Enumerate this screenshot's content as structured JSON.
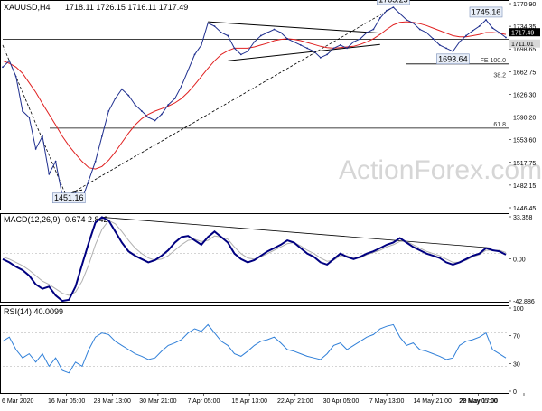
{
  "header": {
    "symbol": "XAUUSD,H4",
    "ohlc": "1718.11 1726.15 1716.11 1717.49"
  },
  "watermark": "ActionForex.com",
  "colors": {
    "price": "#1f2f8f",
    "ma": "#e02020",
    "macd_line": "#000080",
    "macd_signal": "#b0b0b0",
    "rsi": "#2f7fd8",
    "trend": "#000000",
    "level_box": "#e8eef8"
  },
  "chart_data": [
    {
      "type": "line",
      "title": "XAUUSD,H4",
      "ylim": [
        1446.45,
        1770.9
      ],
      "y_ticks": [
        "1770.90",
        "1734.35",
        "1698.65",
        "1662.75",
        "1626.30",
        "1590.20",
        "1553.60",
        "1517.75",
        "1482.15",
        "1446.45"
      ],
      "current_price_labels": [
        "1717.49",
        "1711.01"
      ],
      "x_ticks": [
        "6 Mar 2020",
        "16 Mar 05:00",
        "23 Mar 13:00",
        "30 Mar 21:00",
        "7 Apr 05:00",
        "15 Apr 13:00",
        "22 Apr 21:00",
        "30 Apr 05:00",
        "7 May 13:00",
        "14 May 21:00",
        "22 May 05:00",
        "29 May 17:00"
      ],
      "annotations": [
        {
          "text": "1451.16",
          "price": 1451.16
        },
        {
          "text": "1765.25",
          "price": 1765.25
        },
        {
          "text": "1745.16",
          "price": 1745.16
        },
        {
          "text": "1693.64",
          "price": 1693.64
        }
      ],
      "levels": [
        {
          "label": "FE 100.0",
          "price": 1675
        },
        {
          "label": "38.2",
          "price": 1651
        },
        {
          "label": "61.8",
          "price": 1573
        }
      ],
      "series": [
        {
          "values": [
            1670,
            1680,
            1655,
            1600,
            1590,
            1540,
            1560,
            1500,
            1520,
            1465,
            1455,
            1470,
            1460,
            1490,
            1520,
            1560,
            1600,
            1620,
            1635,
            1625,
            1610,
            1600,
            1590,
            1585,
            1595,
            1610,
            1620,
            1640,
            1665,
            1690,
            1705,
            1740,
            1735,
            1725,
            1720,
            1700,
            1690,
            1695,
            1710,
            1720,
            1725,
            1730,
            1725,
            1715,
            1710,
            1705,
            1700,
            1695,
            1685,
            1690,
            1700,
            1705,
            1700,
            1710,
            1715,
            1725,
            1730,
            1748,
            1760,
            1765,
            1755,
            1745,
            1740,
            1730,
            1725,
            1715,
            1705,
            1700,
            1695,
            1710,
            1720,
            1728,
            1735,
            1745,
            1732,
            1725,
            1717
          ]
        },
        {
          "values": [
            1680,
            1676,
            1670,
            1660,
            1645,
            1630,
            1612,
            1595,
            1578,
            1560,
            1545,
            1532,
            1520,
            1510,
            1508,
            1512,
            1522,
            1535,
            1550,
            1565,
            1578,
            1588,
            1595,
            1600,
            1604,
            1608,
            1613,
            1620,
            1630,
            1642,
            1655,
            1668,
            1680,
            1690,
            1696,
            1700,
            1700,
            1700,
            1702,
            1705,
            1708,
            1712,
            1714,
            1715,
            1714,
            1712,
            1709,
            1706,
            1703,
            1701,
            1700,
            1701,
            1702,
            1703,
            1706,
            1710,
            1715,
            1722,
            1730,
            1737,
            1741,
            1742,
            1741,
            1739,
            1736,
            1732,
            1728,
            1724,
            1720,
            1718,
            1718,
            1720,
            1722,
            1725,
            1725,
            1724,
            1722
          ]
        }
      ]
    },
    {
      "type": "line",
      "title": "MACD(12,26,9) -0.674 2.842",
      "ylim": [
        -42.886,
        33.358
      ],
      "y_ticks": [
        "33.358",
        "0.00",
        "-42.886"
      ],
      "series": [
        {
          "values": [
            -5,
            -8,
            -12,
            -15,
            -20,
            -28,
            -32,
            -30,
            -38,
            -43,
            -42,
            -30,
            -10,
            10,
            28,
            33,
            30,
            20,
            10,
            2,
            -2,
            -5,
            -8,
            -6,
            -2,
            3,
            10,
            15,
            16,
            12,
            8,
            15,
            20,
            15,
            10,
            0,
            -5,
            -8,
            -6,
            -2,
            2,
            5,
            8,
            12,
            10,
            5,
            0,
            -3,
            -8,
            -10,
            -5,
            0,
            -3,
            -5,
            -3,
            0,
            2,
            5,
            8,
            10,
            14,
            10,
            6,
            3,
            0,
            -2,
            -4,
            -8,
            -10,
            -8,
            -5,
            -2,
            0,
            5,
            3,
            2,
            -1
          ]
        },
        {
          "values": [
            -3,
            -5,
            -8,
            -11,
            -15,
            -20,
            -25,
            -28,
            -32,
            -36,
            -38,
            -35,
            -25,
            -10,
            8,
            22,
            30,
            27,
            20,
            12,
            5,
            0,
            -4,
            -6,
            -5,
            -2,
            3,
            8,
            12,
            13,
            11,
            12,
            16,
            15,
            13,
            6,
            0,
            -4,
            -5,
            -3,
            0,
            3,
            6,
            9,
            10,
            7,
            3,
            0,
            -4,
            -7,
            -6,
            -2,
            -2,
            -4,
            -4,
            -1,
            1,
            3,
            6,
            8,
            11,
            11,
            8,
            5,
            2,
            0,
            -2,
            -5,
            -8,
            -8,
            -6,
            -3,
            -1,
            3,
            3,
            3,
            1
          ]
        }
      ]
    },
    {
      "type": "line",
      "title": "RSI(14) 40.0099",
      "ylim": [
        0,
        100
      ],
      "y_ticks": [
        "100",
        "70",
        "30",
        "0"
      ],
      "series": [
        {
          "values": [
            60,
            65,
            50,
            40,
            45,
            35,
            45,
            30,
            40,
            25,
            22,
            35,
            30,
            50,
            65,
            70,
            68,
            60,
            55,
            50,
            45,
            42,
            38,
            40,
            48,
            55,
            58,
            62,
            70,
            75,
            72,
            80,
            70,
            60,
            55,
            45,
            42,
            48,
            55,
            60,
            62,
            65,
            58,
            50,
            48,
            45,
            42,
            40,
            38,
            45,
            55,
            58,
            50,
            55,
            60,
            65,
            68,
            75,
            78,
            80,
            65,
            55,
            58,
            50,
            48,
            45,
            42,
            38,
            40,
            55,
            60,
            62,
            65,
            70,
            50,
            45,
            40
          ]
        }
      ]
    }
  ]
}
